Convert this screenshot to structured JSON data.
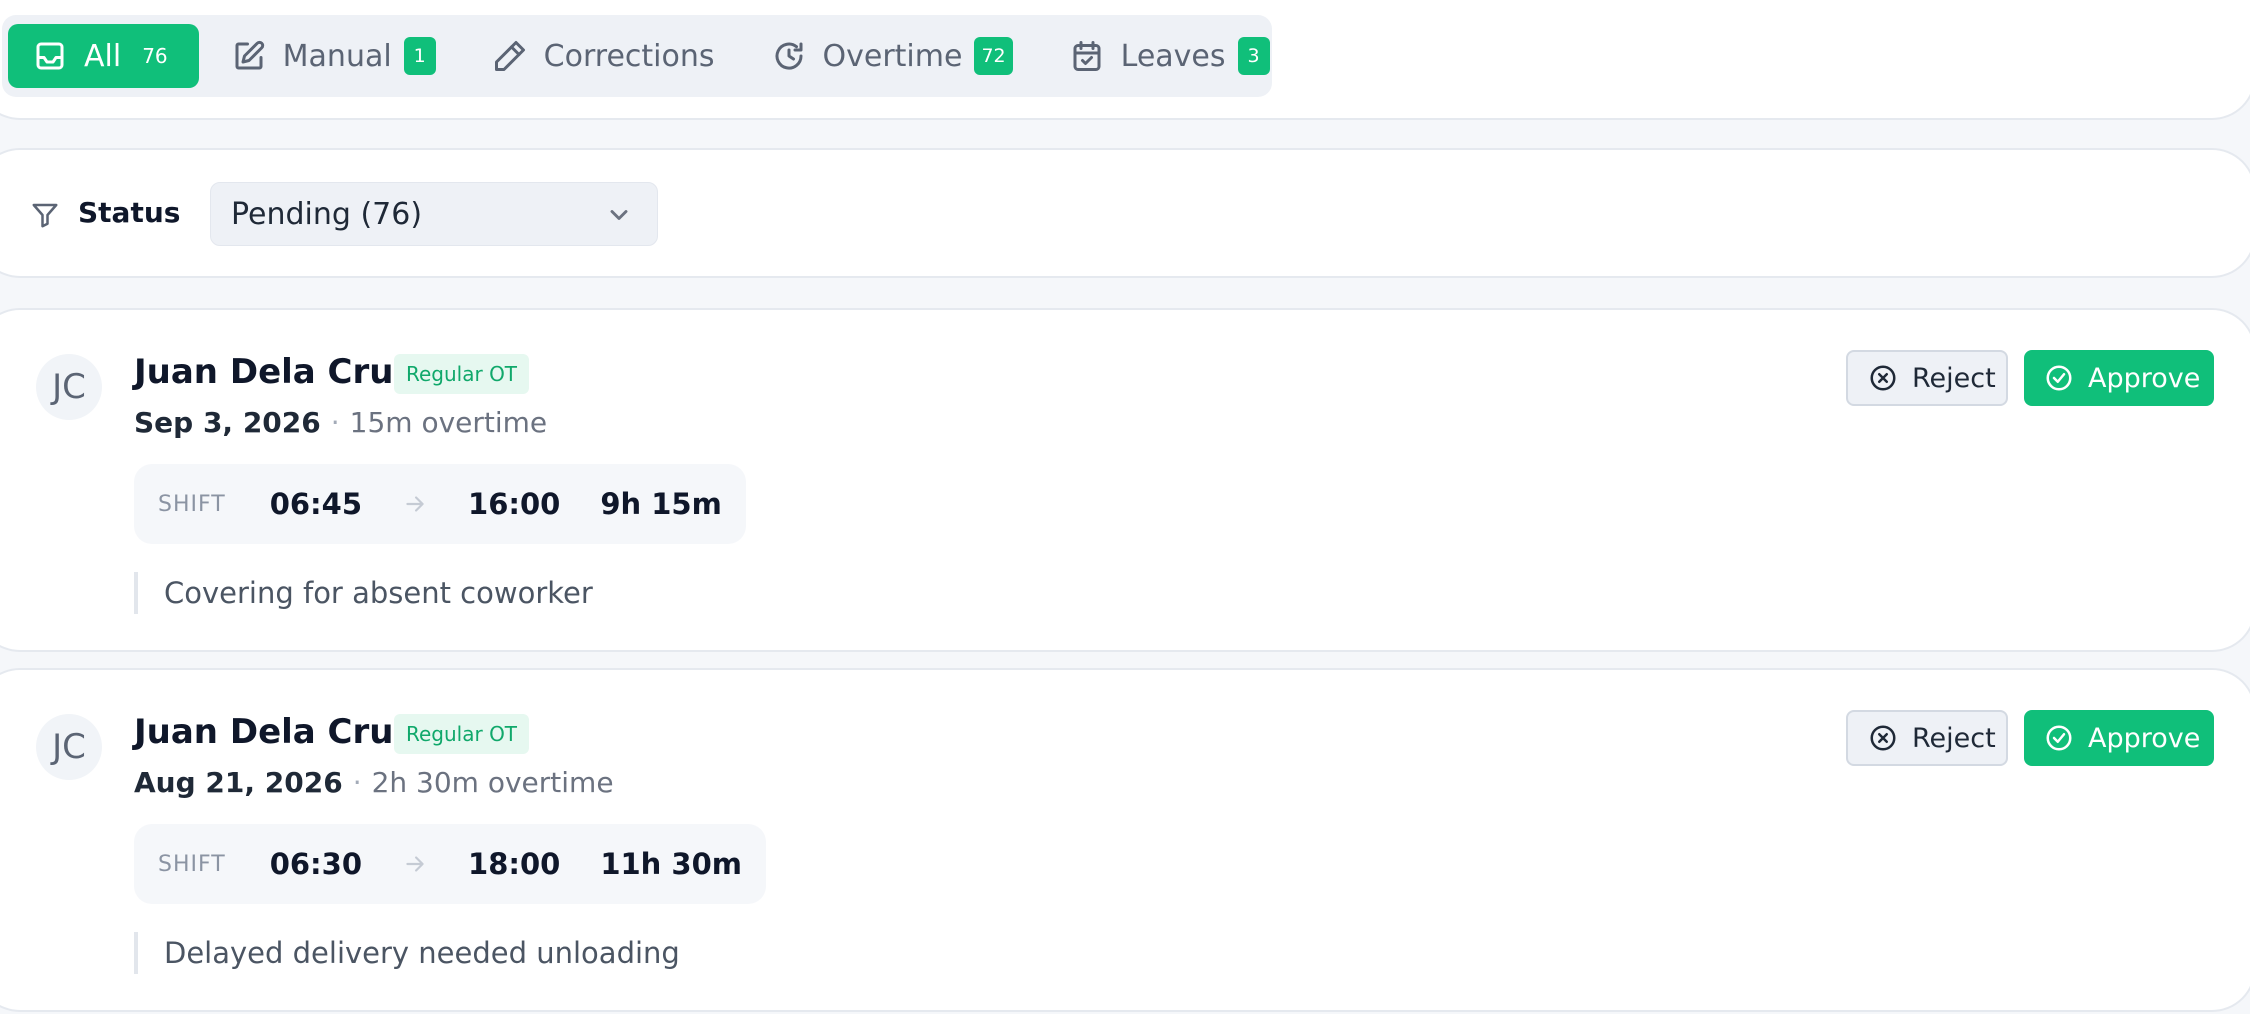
{
  "tabs": [
    {
      "label": "All",
      "count": "76",
      "icon": "inbox-icon",
      "active": true
    },
    {
      "label": "Manual",
      "count": "1",
      "icon": "edit-square-icon"
    },
    {
      "label": "Corrections",
      "count": "",
      "icon": "pencil-icon"
    },
    {
      "label": "Overtime",
      "count": "72",
      "icon": "clock-rotate-icon"
    },
    {
      "label": "Leaves",
      "count": "3",
      "icon": "calendar-check-icon"
    }
  ],
  "filter": {
    "label": "Status",
    "selected": "Pending (76)",
    "icon": "filter-icon"
  },
  "requests": [
    {
      "initials": "JC",
      "name": "Juan Dela Cruz",
      "type": "Regular OT",
      "date": "Sep 3, 2026",
      "overtime": "15m overtime",
      "shift_label": "SHIFT",
      "start": "06:45",
      "end": "16:00",
      "duration": "9h 15m",
      "reason": "Covering for absent coworker",
      "reject_label": "Reject",
      "approve_label": "Approve"
    },
    {
      "initials": "JC",
      "name": "Juan Dela Cruz",
      "type": "Regular OT",
      "date": "Aug 21, 2026",
      "overtime": "2h 30m overtime",
      "shift_label": "SHIFT",
      "start": "06:30",
      "end": "18:00",
      "duration": "11h 30m",
      "reason": "Delayed delivery needed unloading",
      "reject_label": "Reject",
      "approve_label": "Approve"
    }
  ],
  "colors": {
    "accent": "#10bf7a",
    "badge_bg": "#e6f8f0",
    "background": "#f5f7fa"
  }
}
